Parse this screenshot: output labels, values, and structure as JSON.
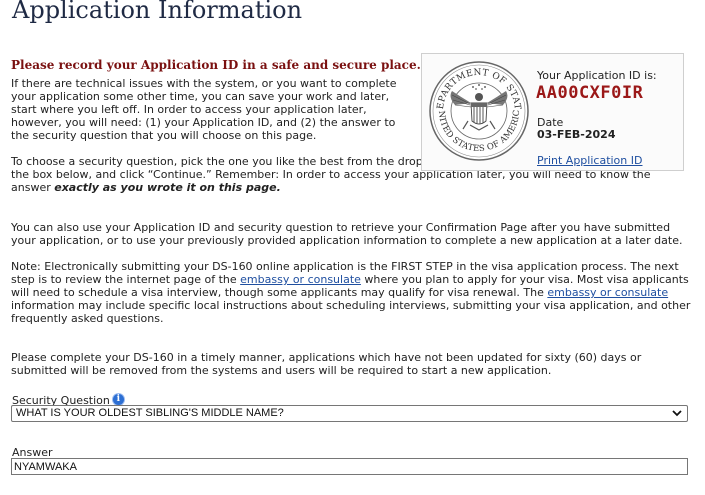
{
  "page": {
    "title": "Application Information",
    "warning": "Please record your Application ID in a safe and secure place.",
    "intro": "If there are technical issues with the system, or you want to complete your application some other time, you can save your work and later, start where you left off. In order to access your application later, however, you will need: (1) your Application ID, and (2) the answer to the security question that you will choose on this page.",
    "choose_text": "To choose a security question, pick the one you like the best from the dropdown list, type your answer to that question in the box below, and click “Continue.” Remember: In order to access your application later, you will need to know the answer",
    "choose_emphasis": "exactly as you wrote it on this page.",
    "retrieve_text": "You can also use your Application ID and security question to retrieve your Confirmation Page after you have submitted your application, or to use your previously provided application information to complete a new application at a later date.",
    "note_part1": "Note: Electronically submitting your DS-160 online application is the FIRST STEP in the visa application process. The next step is to review the internet page of the",
    "note_link1": "embassy or consulate",
    "note_part2": "where you plan to apply for your visa. Most visa applicants will need to schedule a visa interview, though some applicants may qualify for visa renewal. The",
    "note_link2": "embassy or consulate",
    "note_part3": "information may include specific local instructions about scheduling interviews, submitting your visa application, and other frequently asked questions.",
    "timely_text": "Please complete your DS-160 in a timely manner, applications which have not been updated for sixty (60) days or submitted will be removed from the systems and users will be required to start a new application."
  },
  "info_box": {
    "seal_top_text": "DEPARTMENT OF STATE",
    "seal_bottom_text": "UNITED STATES OF AMERICA",
    "id_label": "Your Application ID is:",
    "app_id": "AA00CXF0IR",
    "date_label": "Date",
    "date_value": "03-FEB-2024",
    "print_link": "Print Application ID"
  },
  "form": {
    "security_question_label": "Security Question",
    "info_icon": "i",
    "security_question_value": "WHAT IS YOUR OLDEST SIBLING'S MIDDLE NAME?",
    "answer_label": "Answer",
    "answer_value": "NYAMWAKA"
  },
  "icons": {
    "seal": "department-of-state-seal",
    "info": "info-icon",
    "dropdown": "chevron-down-icon"
  },
  "colors": {
    "title": "#1f2a44",
    "warning": "#7a1010",
    "app_id": "#9b1818",
    "link": "#1f4fa0",
    "info_icon": "#2d6fd3"
  }
}
